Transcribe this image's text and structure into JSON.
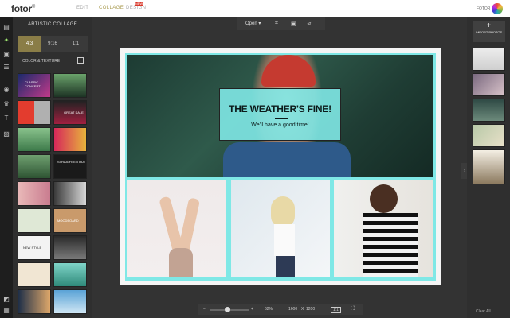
{
  "app": {
    "logo": "fotor",
    "logo_mark": "®",
    "brand": "FOTOR"
  },
  "nav": {
    "edit": "EDIT",
    "collage": "COLLAGE",
    "design": "DESIGN",
    "new_badge": "NEW"
  },
  "panel": {
    "title": "ARTISTIC COLLAGE",
    "ratios": [
      "4:3",
      "9:16",
      "1:1"
    ],
    "selected_ratio": "4:3",
    "section": "COLOR & TEXTURE"
  },
  "toolbar": {
    "open": "Open ▾"
  },
  "canvas": {
    "headline": "THE WEATHER'S FINE!",
    "subline": "We'll have a good time!"
  },
  "bottom": {
    "minus": "−",
    "plus": "+",
    "zoom": "62%",
    "width": "1600",
    "x": "X",
    "height": "1200",
    "ratio_btn": "1:1"
  },
  "right": {
    "import_plus": "+",
    "import_label": "IMPORT PHOTOS",
    "clear_all": "Clear All"
  },
  "thumb_templates": [
    {
      "label": "CLASSIC CONCERT"
    },
    {
      "label": ""
    },
    {
      "label": ""
    },
    {
      "label": "GREAT SALE"
    },
    {
      "label": ""
    },
    {
      "label": ""
    },
    {
      "label": ""
    },
    {
      "label": "STRAIGHTEN OUT"
    },
    {
      "label": ""
    },
    {
      "label": ""
    },
    {
      "label": ""
    },
    {
      "label": ""
    },
    {
      "label": ""
    },
    {
      "label": "MOODBOARD"
    },
    {
      "label": "NEW STYLE"
    },
    {
      "label": ""
    },
    {
      "label": ""
    },
    {
      "label": ""
    },
    {
      "label": ""
    },
    {
      "label": ""
    }
  ],
  "colors": {
    "accent": "#7fe8e6",
    "selected": "#8a7d47"
  }
}
